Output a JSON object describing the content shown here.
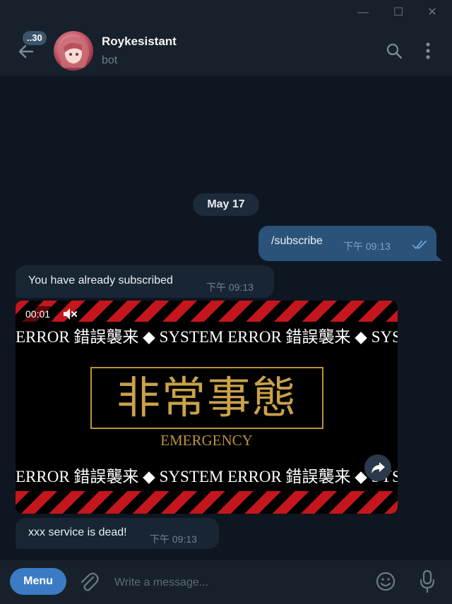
{
  "window": {
    "minimize_glyph": "—",
    "maximize_glyph": "☐",
    "close_glyph": "✕"
  },
  "header": {
    "back_icon": "arrow-left-icon",
    "unread_badge": "..30",
    "name": "Roykesistant",
    "subtitle": "bot",
    "search_icon": "search-icon",
    "more_icon": "kebab-menu-icon"
  },
  "chat": {
    "date_separator": "May 17",
    "messages": [
      {
        "direction": "out",
        "text": "/subscribe",
        "time": "下午 09:13",
        "status": "read"
      },
      {
        "direction": "in",
        "text": "You have already subscribed",
        "time": "下午 09:13"
      },
      {
        "direction": "in",
        "type": "video",
        "duration": "00:01",
        "muted": true,
        "ticker_top": "ERROR 錯誤襲来 ◆ SYSTEM ERROR 錯誤襲来 ◆ SYST",
        "headline": "非常事態",
        "caption": "EMERGENCY",
        "ticker_bottom": "ERROR 錯誤襲来 ◆ SYSTEM ERROR 錯誤襲来 ◆ SYS"
      },
      {
        "direction": "in",
        "text": "xxx service is dead!",
        "time": "下午 09:13"
      }
    ]
  },
  "composer": {
    "menu_label": "Menu",
    "placeholder": "Write a message...",
    "attach_icon": "paperclip-icon",
    "emoji_icon": "smiley-icon",
    "mic_icon": "microphone-icon"
  },
  "colors": {
    "background": "#0e1621",
    "panel": "#17212b",
    "outgoing_bubble": "#2b5278",
    "incoming_bubble": "#182533",
    "accent": "#3a7bc4",
    "alert_red": "#c4161c",
    "gold": "#b9933a"
  }
}
